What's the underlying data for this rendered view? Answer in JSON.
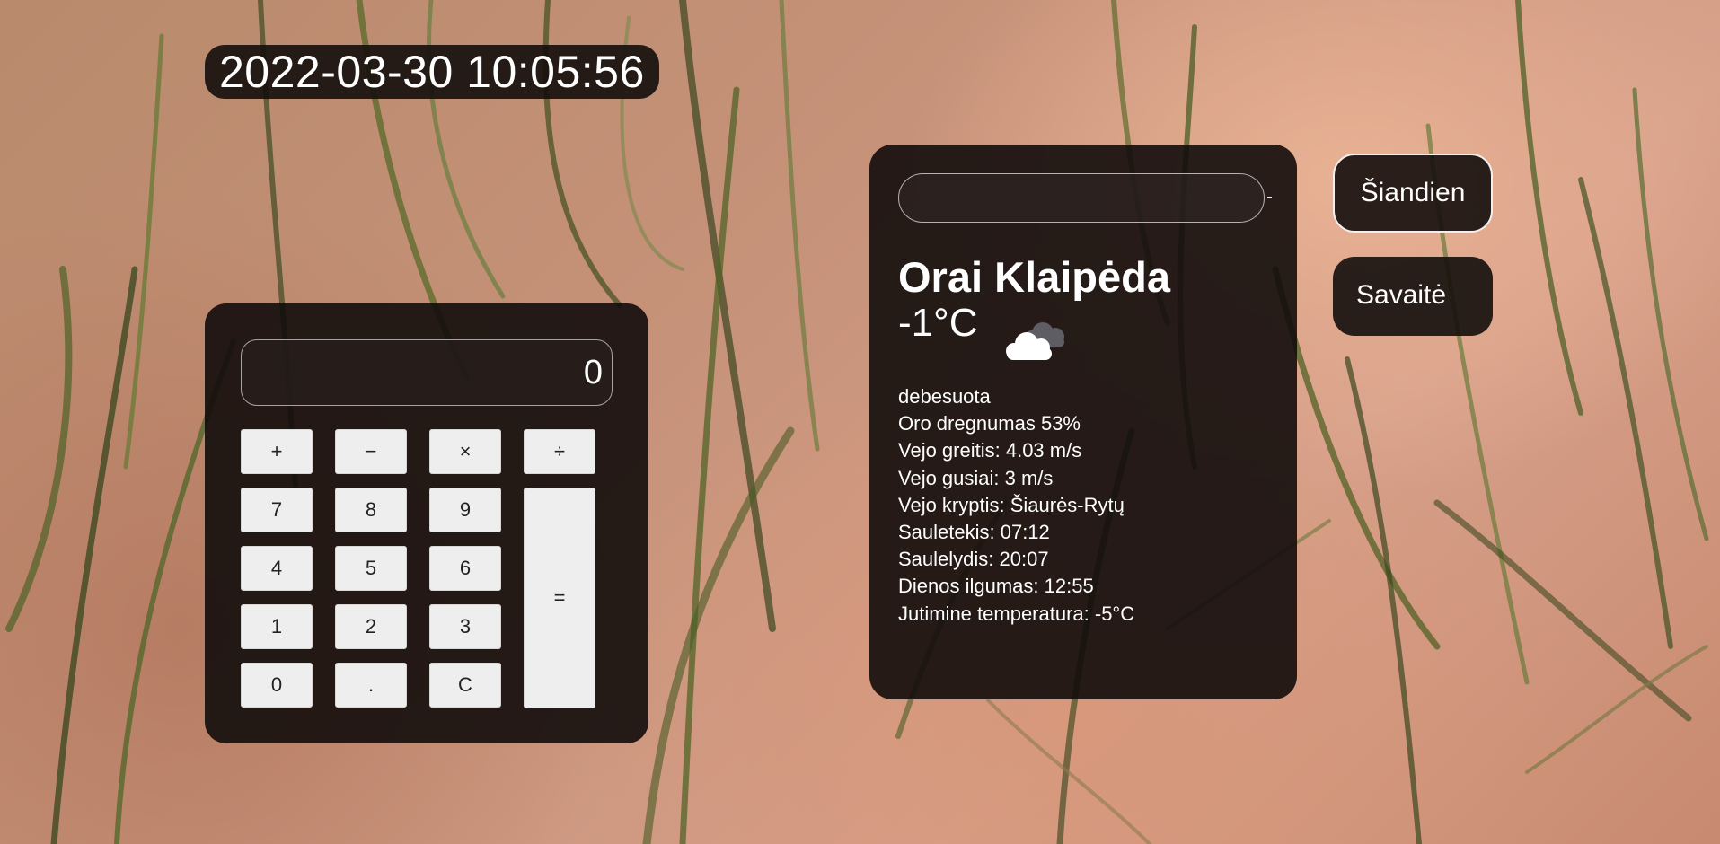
{
  "clock": {
    "datetime": "2022-03-30 10:05:56"
  },
  "calculator": {
    "display": "0",
    "keys": {
      "plus": "+",
      "minus": "−",
      "times": "×",
      "divide": "÷",
      "seven": "7",
      "eight": "8",
      "nine": "9",
      "four": "4",
      "five": "5",
      "six": "6",
      "one": "1",
      "two": "2",
      "three": "3",
      "zero": "0",
      "dot": ".",
      "clear": "C",
      "equals": "="
    }
  },
  "weather": {
    "city_input": {
      "value": "",
      "placeholder": ""
    },
    "title": "Orai Klaipėda",
    "temperature": "-1°C",
    "icon": "cloudy-icon",
    "details": {
      "description": "debesuota",
      "humidity": "Oro dregnumas 53%",
      "wind_speed": "Vejo greitis: 4.03 m/s",
      "wind_gusts": "Vejo gusiai: 3 m/s",
      "wind_direction": "Vejo kryptis: Šiaurės-Rytų",
      "sunrise": "Sauletekis: 07:12",
      "sunset": "Saulelydis: 20:07",
      "day_length": "Dienos ilgumas: 12:55",
      "feels_like": "Jutimine temperatura: -5°C"
    }
  },
  "nav": {
    "today": "Šiandien",
    "week": "Savaitė"
  },
  "colors": {
    "panel": "#140e0c",
    "key": "#efeeef",
    "background": "#c69279"
  }
}
